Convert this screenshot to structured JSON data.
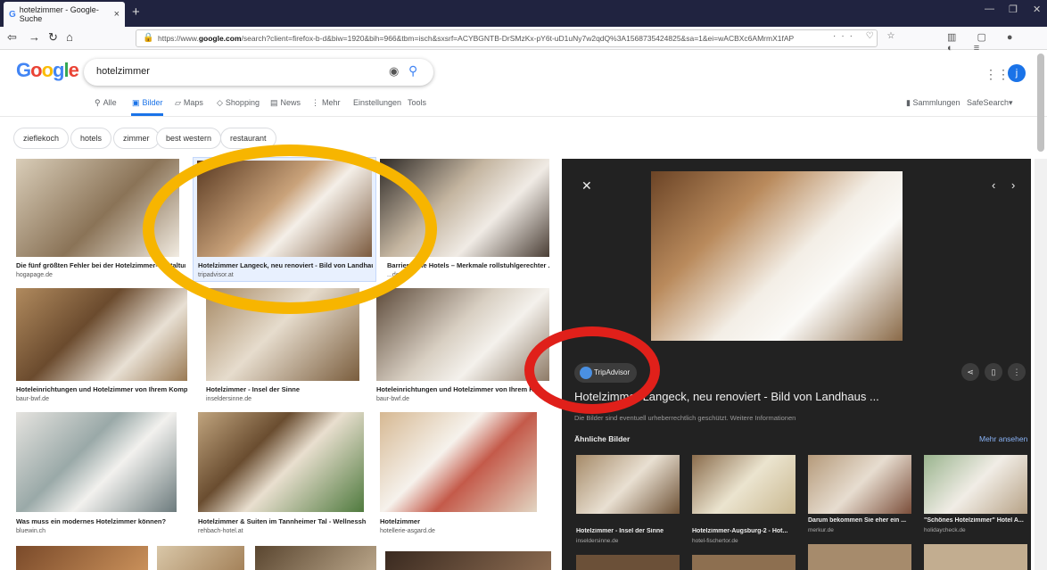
{
  "browser": {
    "tab_title": "hotelzimmer - Google-Suche",
    "url_prefix": "https://www.",
    "url_domain": "google.com",
    "url_rest": "/search?client=firefox-b-d&biw=1920&bih=966&tbm=isch&sxsrf=ACYBGNTB-DrSMzKx-pY6t-uD1uNy7w2qdQ%3A1568735424825&sa=1&ei=wACBXc6AMrmX1fAP"
  },
  "search": {
    "query": "hotelzimmer",
    "logo": "Google"
  },
  "nav": {
    "items": [
      "Alle",
      "Bilder",
      "Maps",
      "Shopping",
      "News",
      "Mehr",
      "Einstellungen",
      "Tools"
    ],
    "right_collections": "Sammlungen",
    "right_safesearch": "SafeSearch"
  },
  "chips": [
    "zieflekoch",
    "hotels",
    "zimmer",
    "best western",
    "restaurant"
  ],
  "results": [
    {
      "caption": "Die fünf größten Fehler bei der Hotelzimmer-Gestaltung",
      "source": "hogapage.de"
    },
    {
      "caption": "Hotelzimmer Langeck, neu renoviert - Bild von Landhaus ...",
      "source": "tripadvisor.at"
    },
    {
      "caption": "Barrierefreie Hotels – Merkmale rollstuhlgerechter ...",
      "source": "...de"
    },
    {
      "caption": "Hoteleinrichtungen und Hotelzimmer von Ihrem Komple...",
      "source": "baur-bwf.de"
    },
    {
      "caption": "Hotelzimmer - Insel der Sinne",
      "source": "inseldersinne.de"
    },
    {
      "caption": "Hoteleinrichtungen und Hotelzimmer von Ihrem Ko...",
      "source": "baur-bwf.de"
    },
    {
      "caption": "Was muss ein modernes Hotelzimmer können?",
      "source": "bluewin.ch"
    },
    {
      "caption": "Hotelzimmer & Suiten im Tannheimer Tal - Wellnessh...",
      "source": "rehbach-hotel.at"
    },
    {
      "caption": "Hotelzimmer",
      "source": "hotellerie-asgard.de"
    }
  ],
  "panel": {
    "source_name": "TripAdvisor",
    "title": "Hotelzimmer Langeck, neu renoviert - Bild von Landhaus ...",
    "copyright": "Die Bilder sind eventuell urheberrechtlich geschützt. Weitere Informationen",
    "similar_label": "Ähnliche Bilder",
    "more_label": "Mehr ansehen",
    "similar": [
      {
        "caption": "Hotelzimmer - Insel der Sinne",
        "source": "inseldersinne.de"
      },
      {
        "caption": "Hotelzimmer-Augsburg-2 - Hot...",
        "source": "hotel-fischertor.de"
      },
      {
        "caption": "Darum bekommen Sie eher ein ...",
        "source": "merkur.de"
      },
      {
        "caption": "\"Schönes Hotelzimmer\" Hotel A...",
        "source": "holidaycheck.de"
      }
    ]
  },
  "colors": {
    "annotation_yellow": "#f7b500",
    "annotation_red": "#e0201a",
    "accent": "#1a73e8"
  }
}
